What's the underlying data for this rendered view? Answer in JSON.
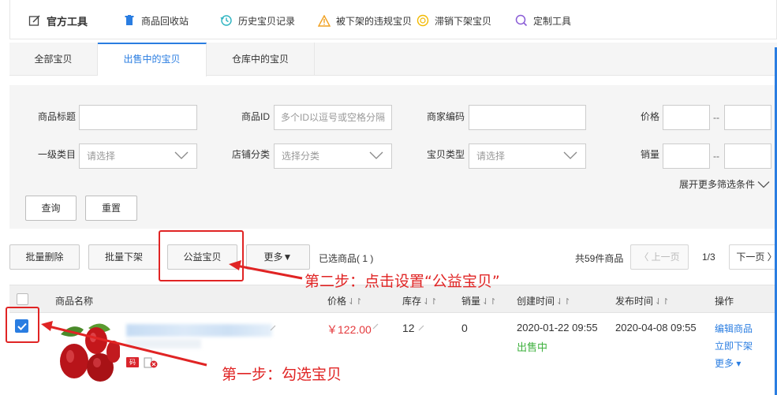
{
  "toolbar": {
    "items": [
      {
        "label": "官方工具"
      },
      {
        "label": "商品回收站"
      },
      {
        "label": "历史宝贝记录"
      },
      {
        "label": "被下架的违规宝贝"
      },
      {
        "label": "滞销下架宝贝"
      },
      {
        "label": "定制工具"
      }
    ]
  },
  "tabs": [
    {
      "label": "全部宝贝"
    },
    {
      "label": "出售中的宝贝",
      "active": true
    },
    {
      "label": "仓库中的宝贝"
    }
  ],
  "filters": {
    "title_label": "商品标题",
    "title_value": "",
    "id_label": "商品ID",
    "id_placeholder": "多个ID以逗号或空格分隔",
    "code_label": "商家编码",
    "code_value": "",
    "price_label": "价格",
    "range_sep": "--",
    "category_label": "一级类目",
    "category_value": "请选择",
    "shopcat_label": "店铺分类",
    "shopcat_value": "选择分类",
    "type_label": "宝贝类型",
    "type_value": "请选择",
    "sales_label": "销量",
    "expand_label": "展开更多筛选条件",
    "search_button": "查询",
    "reset_button": "重置"
  },
  "actions": {
    "batch_delete": "批量删除",
    "batch_offshelf": "批量下架",
    "charity": "公益宝贝",
    "more": "更多▼",
    "selected": "已选商品( 1 )",
    "total": "共59件商品",
    "prev": "〈 上一页",
    "page": "1/3",
    "next": "下一页 〉"
  },
  "table": {
    "columns": [
      {
        "label": "商品名称",
        "sortable": false
      },
      {
        "label": "价格",
        "sortable": true
      },
      {
        "label": "库存",
        "sortable": true
      },
      {
        "label": "销量",
        "sortable": true
      },
      {
        "label": "创建时间",
        "sortable": true
      },
      {
        "label": "发布时间",
        "sortable": true
      },
      {
        "label": "操作",
        "sortable": false
      }
    ],
    "sort_glyph": "⇃↾",
    "rows": [
      {
        "selected": true,
        "tag": "码",
        "price": "￥122.00",
        "stock": "12",
        "sales": "0",
        "created": "2020-01-22 09:55",
        "status": "出售中",
        "published": "2020-04-08 09:55",
        "ops": [
          "编辑商品",
          "立即下架",
          "更多 ▾"
        ]
      }
    ]
  },
  "annotations": {
    "step1": "第一步：勾选宝贝",
    "step2": "第二步：点击设置“公益宝贝”",
    "color": "#e02424"
  },
  "colors": {
    "accent": "#2a7de1",
    "price": "#e4393c",
    "status_ok": "#3db03d"
  }
}
